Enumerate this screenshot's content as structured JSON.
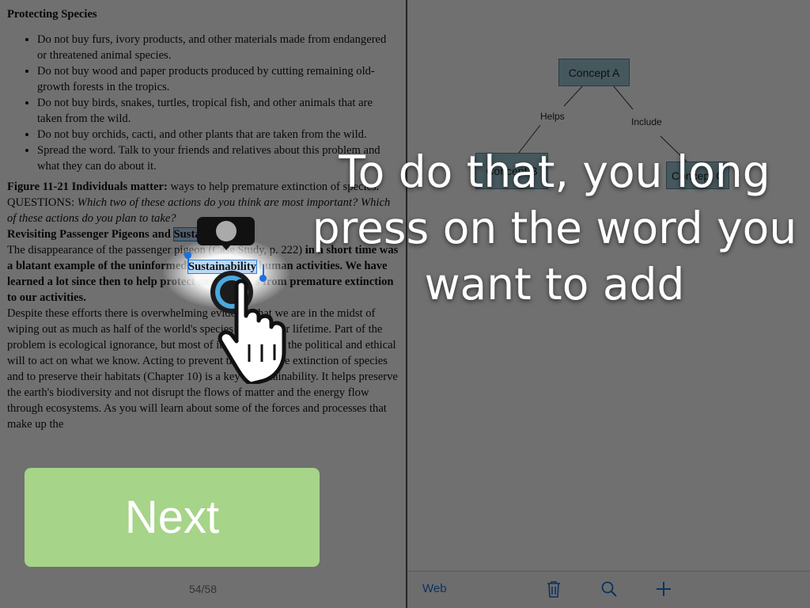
{
  "document": {
    "section_heading": "Protecting Species",
    "bullets": [
      "Do not buy furs, ivory products, and other materials made from endangered or threatened animal species.",
      "Do not buy wood and paper products produced by cutting remaining old-growth forests in the tropics.",
      "Do not buy birds, snakes, turtles, tropical fish, and other animals that are taken from the wild.",
      "Do not buy orchids, cacti, and other plants that are taken from the wild.",
      "Spread the word. Talk to your friends and relatives about this problem and what they can do about it."
    ],
    "figure_caption_bold": "Figure 11-21 Individuals matter:",
    "figure_caption_rest": " ways to help premature extinction of species. QUESTIONS: ",
    "figure_caption_italic": "Which two of these actions do you think are most important? Which of these actions do you plan to take?",
    "subheading_prefix": "Revisiting Passenger Pigeons and ",
    "selected_word": "Sustainability",
    "para1_normal": "The disappearance of the passenger pigeon (Case Study, p. 222)",
    "para1_bold": " in a short time was a blatant example of the uninformed and uncaring human activities. We have learned a lot since then to help protect some species from premature extinction to our activities.",
    "para2": "Despite these efforts there is overwhelming evidence that we are in the midst of wiping out as much as half of the world's species within your lifetime. Part of the problem is ecological ignorance, but most of it is not having the political and ethical will to act on what we know. Acting to prevent the premature extinction of species and to preserve their habitats (Chapter 10) is a key to sustainability. It helps preserve the earth's biodiversity and not disrupt the flows of matter and the energy flow through ecosystems. As you will learn about some of the forces and processes that make up the",
    "page_indicator": "54/58"
  },
  "concept_map": {
    "nodes": [
      {
        "label": "Concept A"
      },
      {
        "label": "Concept B"
      },
      {
        "label": "Concept C"
      }
    ],
    "edge_labels": [
      "Helps",
      "Include"
    ],
    "toolbar": {
      "web_label": "Web",
      "icons": [
        "trash-icon",
        "search-icon",
        "plus-icon"
      ]
    }
  },
  "overlay": {
    "caption": "To do that, you long press on the word you want to add",
    "next_label": "Next"
  },
  "colors": {
    "node_fill": "#9ec9d6",
    "selection": "#bcd8f5",
    "next_button": "#a6d488",
    "toolbar_accent": "#1a73d9"
  }
}
